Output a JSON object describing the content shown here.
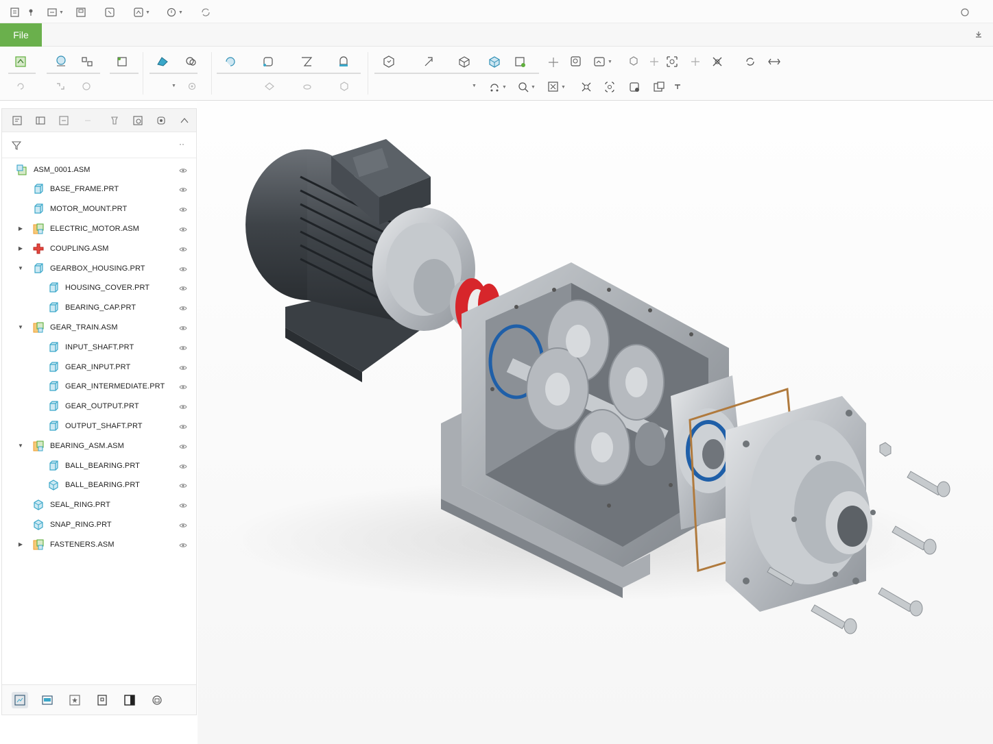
{
  "file_tab": {
    "label": "File"
  },
  "quick_access": {
    "icons": [
      "new-icon",
      "open-icon",
      "save-icon",
      "undo-icon",
      "redo-icon",
      "regenerate-icon",
      "close-window-icon"
    ]
  },
  "ribbon": {
    "icons_row1": [
      "component-icon",
      "assemble-icon",
      "create-icon",
      "repeat-icon",
      "pattern-icon",
      "mirror-icon",
      "extrude-icon",
      "revolve-icon",
      "sweep-icon",
      "blend-icon",
      "datum-plane-icon",
      "datum-axis-icon",
      "part-view-icon",
      "3d-box-icon",
      "shaded-view-icon",
      "move-icon",
      "zoom-icon",
      "view-manager-icon",
      "section-icon",
      "explode-icon",
      "component-interface-icon",
      "rotate-icon",
      "measure-icon"
    ],
    "icons_row2": [
      "undo-icon",
      "drag-icon",
      "refit-icon",
      "settings-icon",
      "orient-icon",
      "perspective-icon",
      "cross-section-icon",
      "arrow-icon"
    ]
  },
  "model_tree": {
    "filter_placeholder": "",
    "more_label": "··",
    "items": [
      {
        "label": "ASM_0001.ASM",
        "type": "asm-root",
        "expand": "",
        "level": 0
      },
      {
        "label": "BASE_FRAME.PRT",
        "type": "part",
        "expand": "",
        "level": 1
      },
      {
        "label": "MOTOR_MOUNT.PRT",
        "type": "part",
        "expand": "",
        "level": 1
      },
      {
        "label": "ELECTRIC_MOTOR.ASM",
        "type": "asm",
        "expand": "▶",
        "level": 1
      },
      {
        "label": "COUPLING.ASM",
        "type": "coupling",
        "expand": "▶",
        "level": 1
      },
      {
        "label": "GEARBOX_HOUSING.PRT",
        "type": "part",
        "expand": "▼",
        "level": 1
      },
      {
        "label": "HOUSING_COVER.PRT",
        "type": "part",
        "expand": "",
        "level": 2
      },
      {
        "label": "BEARING_CAP.PRT",
        "type": "part",
        "expand": "",
        "level": 2
      },
      {
        "label": "GEAR_TRAIN.ASM",
        "type": "asm",
        "expand": "▼",
        "level": 1
      },
      {
        "label": "INPUT_SHAFT.PRT",
        "type": "part",
        "expand": "",
        "level": 2
      },
      {
        "label": "GEAR_INPUT.PRT",
        "type": "part",
        "expand": "",
        "level": 2
      },
      {
        "label": "GEAR_INTERMEDIATE.PRT",
        "type": "part",
        "expand": "",
        "level": 2
      },
      {
        "label": "GEAR_OUTPUT.PRT",
        "type": "part",
        "expand": "",
        "level": 2
      },
      {
        "label": "OUTPUT_SHAFT.PRT",
        "type": "part",
        "expand": "",
        "level": 2
      },
      {
        "label": "BEARING_ASM.ASM",
        "type": "asm",
        "expand": "▼",
        "level": 1
      },
      {
        "label": "BALL_BEARING.PRT",
        "type": "part",
        "expand": "",
        "level": 2
      },
      {
        "label": "BALL_BEARING.PRT",
        "type": "part-alt",
        "expand": "",
        "level": 2
      },
      {
        "label": "SEAL_RING.PRT",
        "type": "part-alt",
        "expand": "",
        "level": 1
      },
      {
        "label": "SNAP_RING.PRT",
        "type": "part-alt",
        "expand": "",
        "level": 1
      },
      {
        "label": "FASTENERS.ASM",
        "type": "asm",
        "expand": "▶",
        "level": 1
      }
    ]
  },
  "panel_bottom": {
    "icons": [
      "model-tree-icon",
      "folder-browser-icon",
      "favorites-icon",
      "layers-icon",
      "split-view-icon",
      "settings-icon"
    ]
  },
  "colors": {
    "file_tab": "#6ab04c",
    "part_icon": "#3aa7c9",
    "asm_icon_green": "#5fae3c",
    "asm_icon_orange": "#f0a23a",
    "coupling_icon": "#d9332b"
  }
}
